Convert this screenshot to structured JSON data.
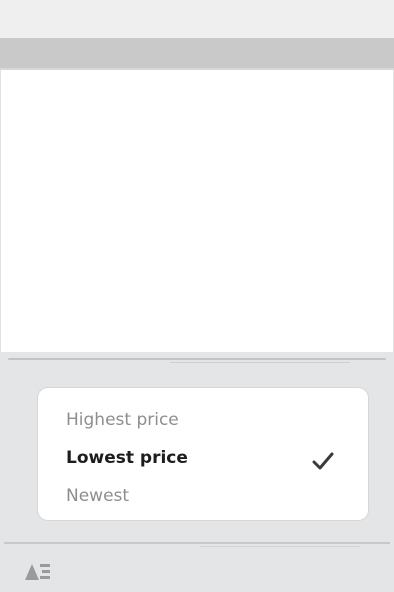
{
  "sort_sheet": {
    "options": [
      {
        "label": "Highest price",
        "selected": false
      },
      {
        "label": "Lowest price",
        "selected": true
      },
      {
        "label": "Newest",
        "selected": false
      }
    ]
  },
  "icons": {
    "selected_marker": "check-icon",
    "toolbar_toggle": "sort-filter-icon"
  },
  "colors": {
    "header": "#c9c9c9",
    "sheet_background": "#e4e5e6",
    "card": "#ffffff",
    "selected_text": "#1d1d1d",
    "unselected_text": "#8e8e8e"
  }
}
